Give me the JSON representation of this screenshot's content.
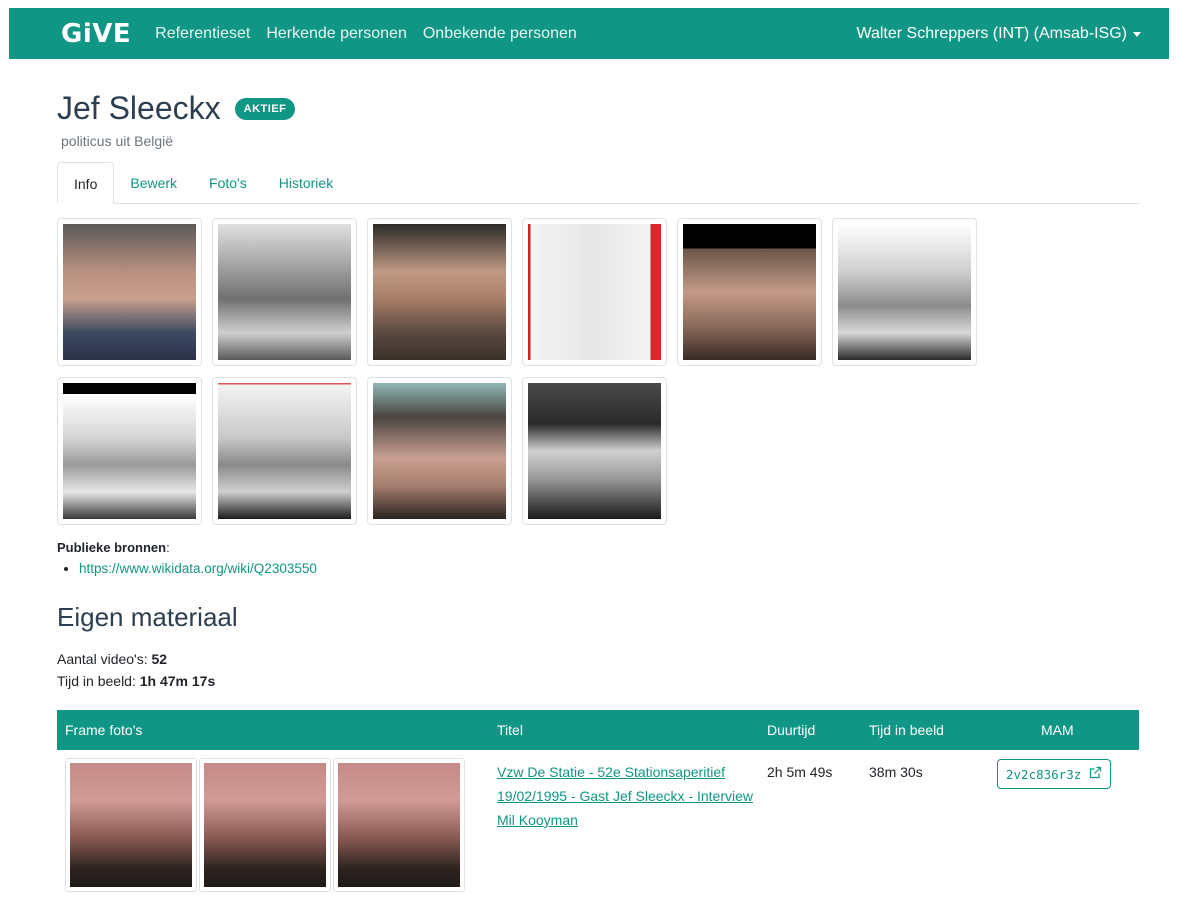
{
  "navbar": {
    "brand": "GiVE",
    "links": [
      "Referentieset",
      "Herkende personen",
      "Onbekende personen"
    ],
    "user": "Walter Schreppers (INT) (Amsab-ISG)"
  },
  "person": {
    "name": "Jef Sleeckx",
    "status": "AKTIEF",
    "description": "politicus uit België"
  },
  "tabs": [
    "Info",
    "Bewerk",
    "Foto's",
    "Historiek"
  ],
  "sources": {
    "label": "Publieke bronnen",
    "links": [
      "https://www.wikidata.org/wiki/Q2303550"
    ]
  },
  "material": {
    "title": "Eigen materiaal",
    "videos_label": "Aantal video's:",
    "videos_value": "52",
    "time_label": "Tijd in beeld:",
    "time_value": "1h 47m 17s"
  },
  "table": {
    "headers": [
      "Frame foto's",
      "Titel",
      "Duurtijd",
      "Tijd in beeld",
      "MAM"
    ],
    "rows": [
      {
        "title": "Vzw De Statie - 52e Stationsaperitief 19/02/1995 - Gast Jef Sleeckx - Interview Mil Kooyman",
        "duration": "2h 5m 49s",
        "screen_time": "38m 30s",
        "mam": "2v2c836r3z"
      }
    ]
  }
}
